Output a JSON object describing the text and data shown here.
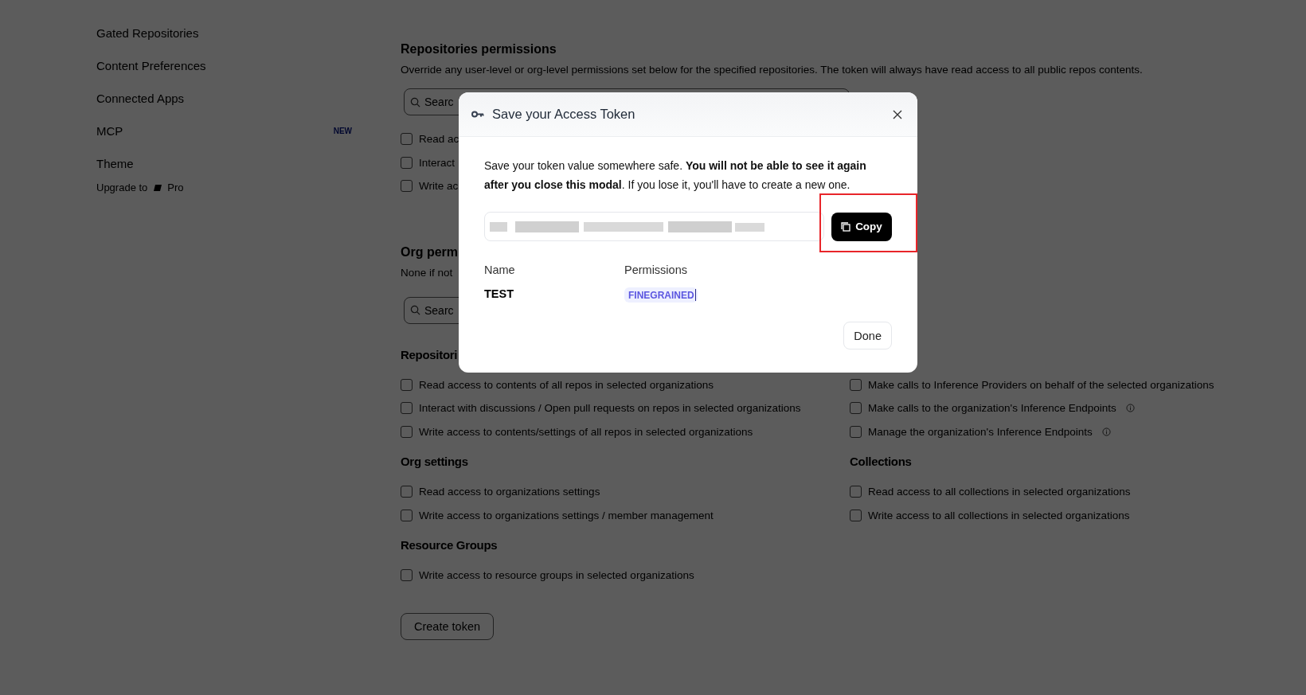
{
  "sidebar": {
    "items": [
      {
        "label": "Gated Repositories"
      },
      {
        "label": "Content Preferences"
      },
      {
        "label": "Connected Apps"
      },
      {
        "label": "MCP",
        "badge": "NEW"
      },
      {
        "label": "Theme"
      }
    ],
    "upgrade": {
      "prefix": "Upgrade to",
      "plan": "Pro"
    }
  },
  "repositories_permissions": {
    "title": "Repositories permissions",
    "description": "Override any user-level or org-level permissions set below for the specified repositories. The token will always have read access to all public repos contents.",
    "search": {
      "placeholder": "Searc"
    },
    "options": [
      {
        "label": "Read ac",
        "checked": false
      },
      {
        "label": "Interact",
        "checked": false
      },
      {
        "label": "Write ac",
        "checked": false
      }
    ]
  },
  "org_permissions": {
    "title": "Org perm",
    "description": "None if not",
    "search": {
      "placeholder": "Searc"
    },
    "left_groups": [
      {
        "title": "Repositori",
        "options": [
          {
            "label": "Read access to contents of all repos in selected organizations",
            "checked": false,
            "info": false
          },
          {
            "label": "Interact with discussions / Open pull requests on repos in selected organizations",
            "checked": false,
            "info": false
          },
          {
            "label": "Write access to contents/settings of all repos in selected organizations",
            "checked": false,
            "info": false
          }
        ]
      },
      {
        "title": "Org settings",
        "options": [
          {
            "label": "Read access to organizations settings",
            "checked": false,
            "info": false
          },
          {
            "label": "Write access to organizations settings / member management",
            "checked": false,
            "info": false
          }
        ]
      },
      {
        "title": "Resource Groups",
        "options": [
          {
            "label": "Write access to resource groups in selected organizations",
            "checked": false,
            "info": false
          }
        ]
      }
    ],
    "right_groups": [
      {
        "options": [
          {
            "label": "Make calls to Inference Providers on behalf of the selected organizations",
            "checked": false,
            "info": false
          },
          {
            "label": "Make calls to the organization's Inference Endpoints",
            "checked": false,
            "info": true
          },
          {
            "label": "Manage the organization's Inference Endpoints",
            "checked": false,
            "info": true
          }
        ]
      },
      {
        "title": "Collections",
        "options": [
          {
            "label": "Read access to all collections in selected organizations",
            "checked": false,
            "info": false
          },
          {
            "label": "Write access to all collections in selected organizations",
            "checked": false,
            "info": false
          }
        ]
      }
    ]
  },
  "create_button": "Create token",
  "modal": {
    "title": "Save your Access Token",
    "message": "Save your token value somewhere safe. **You will not be able to see it again after you close this modal**. If you lose it, you'll have to create a new one.",
    "copy_button": "Copy",
    "copy_highlighted": true,
    "columns": [
      "Name",
      "Permissions"
    ],
    "token_name": "TEST",
    "permission": "FINEGRAINED",
    "done_button": "Done"
  }
}
